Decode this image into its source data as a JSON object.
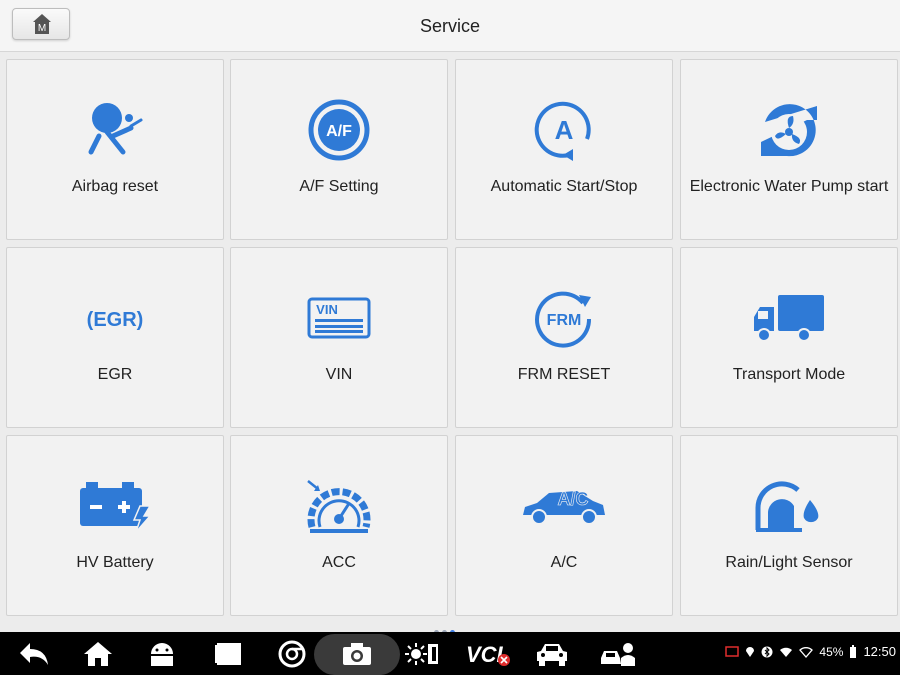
{
  "header": {
    "home_label": "M",
    "title": "Service"
  },
  "tiles": [
    {
      "label": "Airbag reset"
    },
    {
      "label": "A/F Setting"
    },
    {
      "label": "Automatic Start/Stop"
    },
    {
      "label": "Electronic Water Pump start"
    },
    {
      "label": "EGR"
    },
    {
      "label": "VIN"
    },
    {
      "label": "FRM RESET"
    },
    {
      "label": "Transport Mode"
    },
    {
      "label": "HV Battery"
    },
    {
      "label": "ACC"
    },
    {
      "label": "A/C"
    },
    {
      "label": "Rain/Light Sensor"
    }
  ],
  "icon_text": {
    "af": "A/F",
    "auto": "A",
    "egr": "(EGR)",
    "vin": "VIN",
    "frm": "FRM",
    "ac": "A/C"
  },
  "pager": {
    "pages": 3,
    "current": 3
  },
  "navbar": {
    "vci_label": "VCI"
  },
  "status": {
    "battery": "45%",
    "time": "12:50"
  },
  "colors": {
    "accent": "#2f7ad6",
    "navbar": "#000000",
    "tile_bg": "#f2f2f2"
  }
}
